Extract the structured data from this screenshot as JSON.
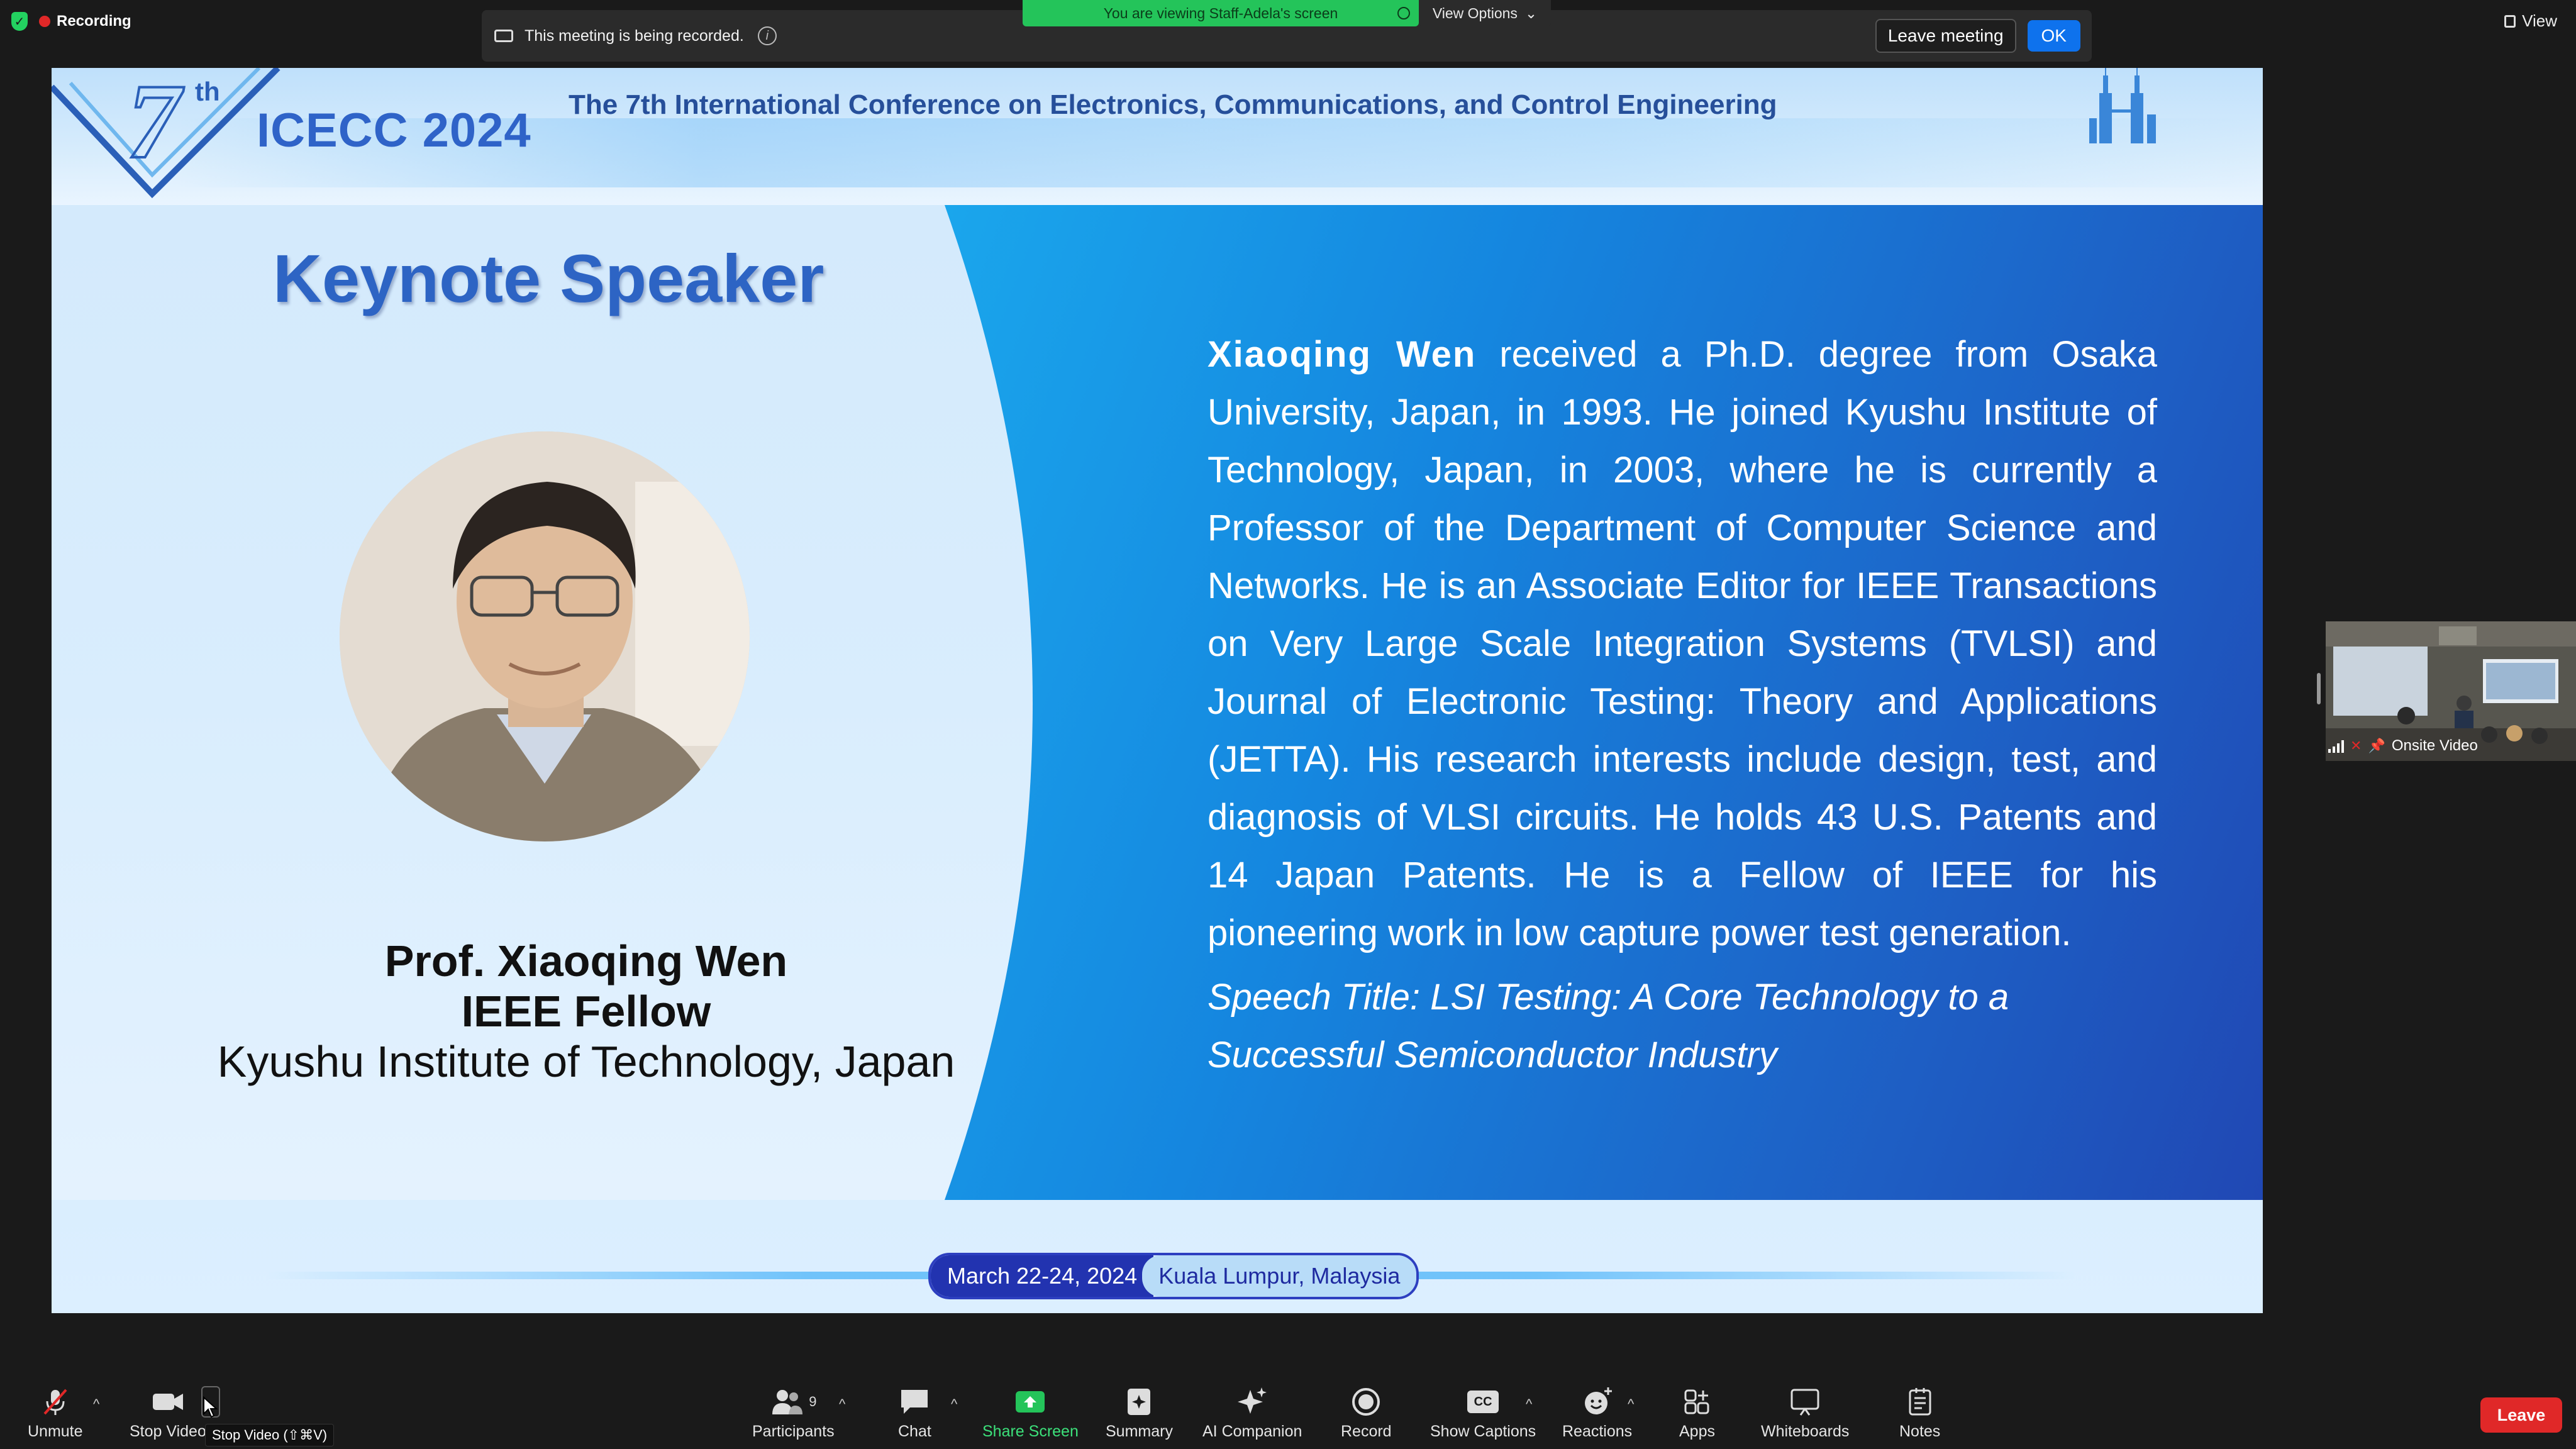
{
  "top": {
    "recording_label": "Recording",
    "recording_notice": "This meeting is being recorded.",
    "leave_meeting_label": "Leave meeting",
    "ok_label": "OK",
    "viewing_banner": "You are viewing Staff-Adela's screen",
    "view_options_label": "View Options",
    "view_label": "View"
  },
  "slide": {
    "logo_number": "7",
    "logo_suffix": "th",
    "logo_text": "ICECC 2024",
    "conference_title": "The 7th International Conference on Electronics, Communications, and Control Engineering",
    "keynote_heading": "Keynote Speaker",
    "speaker_name": "Prof. Xiaoqing Wen",
    "speaker_fellow": "IEEE Fellow",
    "speaker_affiliation": "Kyushu Institute of Technology, Japan",
    "bio_name": "Xiaoqing Wen",
    "bio_text": " received a Ph.D. degree from Osaka University, Japan, in 1993. He joined Kyushu Institute of Technology, Japan, in 2003, where he is currently a Professor of the Department of Computer Science and Networks. He is an Associate Editor for IEEE Transactions on Very Large Scale Integration Systems (TVLSI) and Journal of Electronic Testing: Theory and Applications (JETTA). His research interests include design, test, and diagnosis of VLSI circuits. He holds 43 U.S. Patents and 14 Japan Patents. He is a Fellow of IEEE for his pioneering work in low capture power test generation.",
    "speech_title": "Speech Title: LSI Testing: A Core Technology to a Successful Semiconductor Industry",
    "date": "March 22-24, 2024",
    "location": "Kuala Lumpur, Malaysia"
  },
  "thumbnail": {
    "label": "Onsite Video"
  },
  "toolbar": {
    "unmute": "Unmute",
    "stop_video": "Stop Video",
    "stop_video_tooltip": "Stop Video (⇧⌘V)",
    "participants": "Participants",
    "participants_count": "9",
    "chat": "Chat",
    "share_screen": "Share Screen",
    "summary": "Summary",
    "ai_companion": "AI Companion",
    "record": "Record",
    "show_captions": "Show Captions",
    "captions_icon_text": "CC",
    "reactions": "Reactions",
    "apps": "Apps",
    "whiteboards": "Whiteboards",
    "notes": "Notes",
    "leave": "Leave"
  },
  "colors": {
    "share_green": "#24c45a",
    "leave_red": "#e02828",
    "ok_blue": "#0e72ed",
    "slide_blue": "#2d64c4"
  }
}
